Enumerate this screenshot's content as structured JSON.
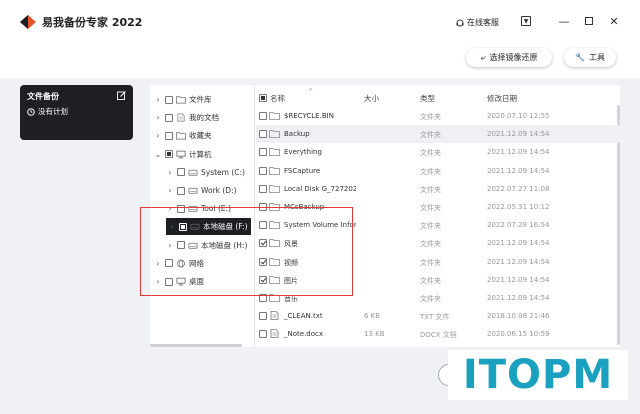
{
  "app": {
    "title": "易我备份专家 2022",
    "online_service": "在线客服"
  },
  "toolbar": {
    "restore_label": "选择镜像还原",
    "tools_label": "工具"
  },
  "plan": {
    "title": "文件备份",
    "subtitle": "没有计划"
  },
  "tree": [
    {
      "label": "文件库",
      "indent": 0,
      "chevron": ">",
      "state": "none",
      "icon": "library-icon"
    },
    {
      "label": "我的文档",
      "indent": 0,
      "chevron": ">",
      "state": "none",
      "icon": "document-icon"
    },
    {
      "label": "收藏夹",
      "indent": 0,
      "chevron": ">",
      "state": "none",
      "icon": "favorites-icon"
    },
    {
      "label": "计算机",
      "indent": 0,
      "chevron": "v",
      "state": "partial",
      "icon": "computer-icon"
    },
    {
      "label": "System (C:)",
      "indent": 1,
      "chevron": ">",
      "state": "none",
      "icon": "drive-icon"
    },
    {
      "label": "Work (D:)",
      "indent": 1,
      "chevron": ">",
      "state": "none",
      "icon": "drive-icon"
    },
    {
      "label": "Tool (E:)",
      "indent": 1,
      "chevron": ">",
      "state": "none",
      "icon": "drive-icon"
    },
    {
      "label": "本地磁盘 (F:)",
      "indent": 1,
      "chevron": ">",
      "state": "partial",
      "icon": "drive-icon",
      "selected": true
    },
    {
      "label": "本地磁盘 (H:)",
      "indent": 1,
      "chevron": ">",
      "state": "none",
      "icon": "drive-icon"
    },
    {
      "label": "网络",
      "indent": 0,
      "chevron": ">",
      "state": "none",
      "icon": "network-icon"
    },
    {
      "label": "桌面",
      "indent": 0,
      "chevron": ">",
      "state": "none",
      "icon": "desktop-icon"
    }
  ],
  "list": {
    "headers": {
      "name": "名称",
      "size": "大小",
      "type": "类型",
      "date": "修改日期"
    },
    "rows": [
      {
        "name": "$RECYCLE.BIN",
        "size": "",
        "type": "文件夹",
        "date": "2020.07.10 12:55",
        "checked": false,
        "icon": "folder-icon"
      },
      {
        "name": "Backup",
        "size": "",
        "type": "文件夹",
        "date": "2021.12.09 14:54",
        "checked": false,
        "icon": "folder-icon",
        "highlight": true
      },
      {
        "name": "Everything",
        "size": "",
        "type": "文件夹",
        "date": "2021.12.09 14:54",
        "checked": false,
        "icon": "folder-icon"
      },
      {
        "name": "FSCapture",
        "size": "",
        "type": "文件夹",
        "date": "2021.12.09 14:54",
        "checked": false,
        "icon": "folder-icon"
      },
      {
        "name": "Local Disk G_727202...",
        "size": "",
        "type": "文件夹",
        "date": "2022.07.27 11:08",
        "checked": false,
        "icon": "folder-icon"
      },
      {
        "name": "MCsBackup",
        "size": "",
        "type": "文件夹",
        "date": "2022.05.31 10:12",
        "checked": false,
        "icon": "folder-icon"
      },
      {
        "name": "System Volume Infor...",
        "size": "",
        "type": "文件夹",
        "date": "2022.07.28 16:54",
        "checked": false,
        "icon": "folder-icon"
      },
      {
        "name": "风景",
        "size": "",
        "type": "文件夹",
        "date": "2021.12.09 14:54",
        "checked": true,
        "icon": "folder-icon"
      },
      {
        "name": "视频",
        "size": "",
        "type": "文件夹",
        "date": "2021.12.09 14:54",
        "checked": true,
        "icon": "folder-icon"
      },
      {
        "name": "图片",
        "size": "",
        "type": "文件夹",
        "date": "2021.12.09 14:54",
        "checked": true,
        "icon": "folder-icon"
      },
      {
        "name": "音乐",
        "size": "",
        "type": "文件夹",
        "date": "2021.12.09 14:54",
        "checked": false,
        "icon": "folder-icon"
      },
      {
        "name": "_CLEAN.txt",
        "size": "6 KB",
        "type": "TXT 文件",
        "date": "2018.10.08 21:46",
        "checked": false,
        "icon": "text-file-icon"
      },
      {
        "name": "_Note.docx",
        "size": "13 KB",
        "type": "DOCX 文档",
        "date": "2020.06.15 10:59",
        "checked": false,
        "icon": "docx-file-icon"
      }
    ]
  },
  "watermark": "ITOPM",
  "colors": {
    "accent_dark": "#1d1f23",
    "annotation_red": "#e03a3a",
    "watermark": "#1aa1bf"
  }
}
